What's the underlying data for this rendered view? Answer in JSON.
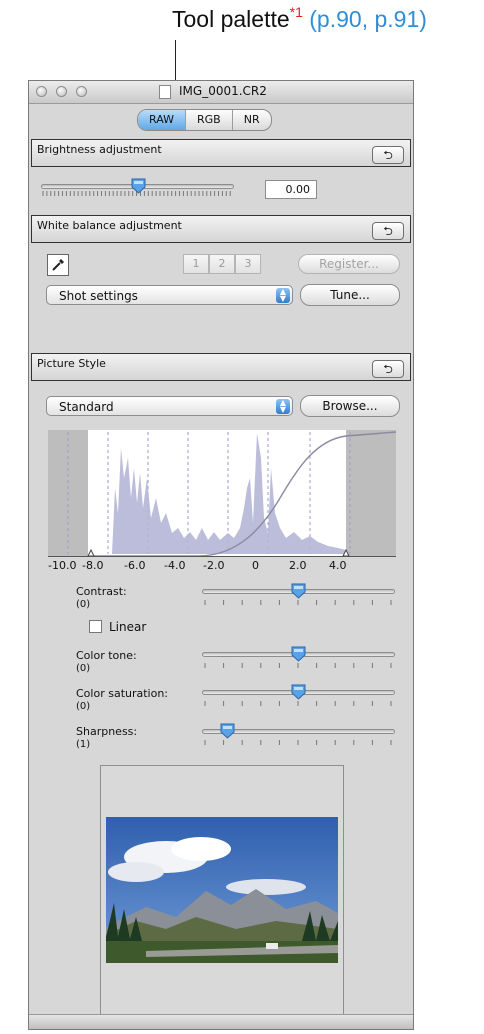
{
  "caption": {
    "text": "Tool palette",
    "sup": "*1",
    "refs": " (p.90, p.91)"
  },
  "window": {
    "title": "IMG_0001.CR2",
    "tabs": [
      {
        "label": "RAW",
        "active": true
      },
      {
        "label": "RGB",
        "active": false
      },
      {
        "label": "NR",
        "active": false
      }
    ]
  },
  "brightness": {
    "header": "Brightness adjustment",
    "value": "0.00",
    "slider_fraction": 0.5
  },
  "white_balance": {
    "header": "White balance adjustment",
    "slots": [
      "1",
      "2",
      "3"
    ],
    "register_label": "Register...",
    "preset": "Shot settings",
    "tune_label": "Tune..."
  },
  "picture_style": {
    "header": "Picture Style",
    "style": "Standard",
    "browse_label": "Browse...",
    "axis_ticks": [
      "-10.0",
      "-8.0",
      "-6.0",
      "-4.0",
      "-2.0",
      "0",
      "2.0",
      "4.0"
    ],
    "contrast": {
      "label": "Contrast:",
      "value": "(0)",
      "fraction": 0.5
    },
    "linear_label": "Linear",
    "color_tone": {
      "label": "Color tone:",
      "value": "(0)",
      "fraction": 0.5
    },
    "color_saturation": {
      "label": "Color saturation:",
      "value": "(0)",
      "fraction": 0.5
    },
    "sharpness": {
      "label": "Sharpness:",
      "value": "(1)",
      "fraction": 0.1
    }
  },
  "icons": [
    "eyedropper-icon",
    "reset-icon",
    "popup-arrows-icon",
    "slider-thumb-icon"
  ],
  "colors": {
    "accent": "#5fa8e8",
    "caption_sup": "#e0201f",
    "caption_refs": "#2e8fd6",
    "histogram": "#b4b6d6"
  }
}
